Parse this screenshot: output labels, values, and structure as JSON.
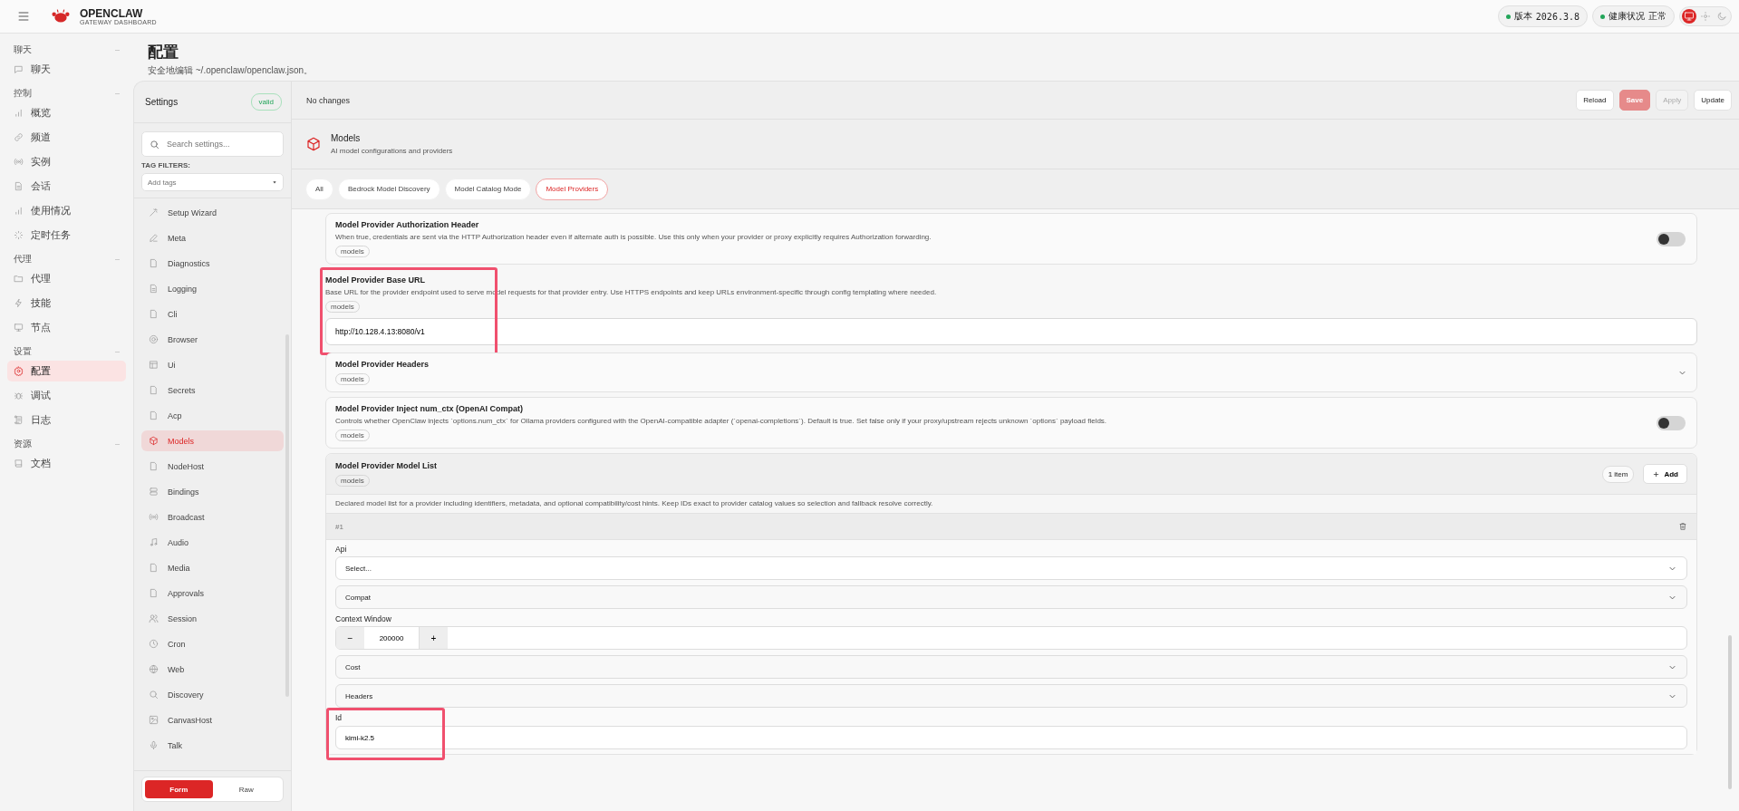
{
  "topbar": {
    "brand": "OPENCLAW",
    "subtitle": "GATEWAY DASHBOARD",
    "status_pills": [
      {
        "label": "版本",
        "value": "2026.3.8",
        "color": "#22a559"
      },
      {
        "label": "健康状况",
        "value": "正常",
        "color": "#22a559"
      }
    ],
    "theme_modes": [
      {
        "kind": "system",
        "selected": true
      },
      {
        "kind": "light",
        "selected": false
      },
      {
        "kind": "dark",
        "selected": false
      }
    ]
  },
  "nav": [
    {
      "title": "聊天",
      "items": [
        {
          "label": "聊天",
          "kind": "chat",
          "selected": false
        }
      ]
    },
    {
      "title": "控制",
      "items": [
        {
          "label": "概览",
          "kind": "bars",
          "selected": false
        },
        {
          "label": "频道",
          "kind": "link",
          "selected": false
        },
        {
          "label": "实例",
          "kind": "radio",
          "selected": false
        },
        {
          "label": "会话",
          "kind": "doc",
          "selected": false
        },
        {
          "label": "使用情况",
          "kind": "bars",
          "selected": false
        },
        {
          "label": "定时任务",
          "kind": "spinner",
          "selected": false
        }
      ]
    },
    {
      "title": "代理",
      "items": [
        {
          "label": "代理",
          "kind": "folder",
          "selected": false
        },
        {
          "label": "技能",
          "kind": "bolt",
          "selected": false
        },
        {
          "label": "节点",
          "kind": "monitor",
          "selected": false
        }
      ]
    },
    {
      "title": "设置",
      "items": [
        {
          "label": "配置",
          "kind": "gear",
          "selected": true
        },
        {
          "label": "调试",
          "kind": "bug",
          "selected": false
        },
        {
          "label": "日志",
          "kind": "scroll",
          "selected": false
        }
      ]
    },
    {
      "title": "资源",
      "items": [
        {
          "label": "文档",
          "kind": "book",
          "selected": false
        }
      ]
    }
  ],
  "page": {
    "title": "配置",
    "subtitle": "安全地编辑 ~/.openclaw/openclaw.json。"
  },
  "settings": {
    "title": "Settings",
    "status": "valid",
    "search_placeholder": "Search settings...",
    "tag_filters_label": "TAG FILTERS:",
    "tags_placeholder": "Add tags",
    "sections": [
      {
        "label": "Setup Wizard",
        "kind": "wand",
        "selected": false
      },
      {
        "label": "Meta",
        "kind": "pen",
        "selected": false
      },
      {
        "label": "Diagnostics",
        "kind": "file",
        "selected": false
      },
      {
        "label": "Logging",
        "kind": "doc",
        "selected": false
      },
      {
        "label": "Cli",
        "kind": "file",
        "selected": false
      },
      {
        "label": "Browser",
        "kind": "ring",
        "selected": false
      },
      {
        "label": "Ui",
        "kind": "layout",
        "selected": false
      },
      {
        "label": "Secrets",
        "kind": "file",
        "selected": false
      },
      {
        "label": "Acp",
        "kind": "file",
        "selected": false
      },
      {
        "label": "Models",
        "kind": "cube",
        "selected": true
      },
      {
        "label": "NodeHost",
        "kind": "file",
        "selected": false
      },
      {
        "label": "Bindings",
        "kind": "server",
        "selected": false
      },
      {
        "label": "Broadcast",
        "kind": "radio",
        "selected": false
      },
      {
        "label": "Audio",
        "kind": "music",
        "selected": false
      },
      {
        "label": "Media",
        "kind": "file",
        "selected": false
      },
      {
        "label": "Approvals",
        "kind": "file",
        "selected": false
      },
      {
        "label": "Session",
        "kind": "users",
        "selected": false
      },
      {
        "label": "Cron",
        "kind": "clock",
        "selected": false
      },
      {
        "label": "Web",
        "kind": "globe",
        "selected": false
      },
      {
        "label": "Discovery",
        "kind": "search",
        "selected": false
      },
      {
        "label": "CanvasHost",
        "kind": "image",
        "selected": false
      },
      {
        "label": "Talk",
        "kind": "mic",
        "selected": false
      }
    ],
    "modes": [
      {
        "label": "Form",
        "selected": true
      },
      {
        "label": "Raw",
        "selected": false
      }
    ]
  },
  "toolbar": {
    "status": "No changes",
    "buttons": [
      {
        "label": "Reload",
        "kind": "default",
        "disabled": false
      },
      {
        "label": "Save",
        "kind": "primary",
        "disabled": true
      },
      {
        "label": "Apply",
        "kind": "default",
        "disabled": true
      },
      {
        "label": "Update",
        "kind": "default",
        "disabled": false
      }
    ]
  },
  "section": {
    "title": "Models",
    "description": "AI model configurations and providers",
    "tabs": [
      {
        "label": "All",
        "selected": false
      },
      {
        "label": "Bedrock Model Discovery",
        "selected": false
      },
      {
        "label": "Model Catalog Mode",
        "selected": false
      },
      {
        "label": "Model Providers",
        "selected": true
      }
    ]
  },
  "fields": [
    {
      "kind": "toggle",
      "title": "Model Provider Authorization Header",
      "description": "When true, credentials are sent via the HTTP Authorization header even if alternate auth is possible. Use this only when your provider or proxy explicitly requires Authorization forwarding.",
      "tag": "models",
      "on": false
    },
    {
      "kind": "text",
      "title": "Model Provider Base URL",
      "description": "Base URL for the provider endpoint used to serve model requests for that provider entry. Use HTTPS endpoints and keep URLs environment-specific through config templating where needed.",
      "tag": "models",
      "value": "http://10.128.4.13:8080/v1",
      "highlighted": true
    },
    {
      "kind": "collapsible",
      "title": "Model Provider Headers",
      "tag": "models"
    },
    {
      "kind": "toggle",
      "title": "Model Provider Inject num_ctx (OpenAI Compat)",
      "description": "Controls whether OpenClaw injects `options.num_ctx` for Ollama providers configured with the OpenAI-compatible adapter (`openai-completions`). Default is true. Set false only if your proxy/upstream rejects unknown `options` payload fields.",
      "tag": "models",
      "on": false
    },
    {
      "kind": "list",
      "title": "Model Provider Model List",
      "tag": "models",
      "count": "1 item",
      "add_label": "Add",
      "description": "Declared model list for a provider including identifiers, metadata, and optional compatibility/cost hints. Keep IDs exact to provider catalog values so selection and fallback resolve correctly.",
      "items": [
        {
          "index": "#1",
          "fields": [
            {
              "kind": "select",
              "label": "Api",
              "placeholder": "Select..."
            },
            {
              "kind": "collapsible",
              "label": "Compat"
            },
            {
              "kind": "number",
              "label": "Context Window",
              "value": "200000",
              "minus": "−",
              "plus": "+"
            },
            {
              "kind": "collapsible",
              "label": "Cost"
            },
            {
              "kind": "collapsible",
              "label": "Headers"
            },
            {
              "kind": "text",
              "label": "Id",
              "value": "kimi-k2.5",
              "highlighted": true
            }
          ]
        }
      ]
    }
  ]
}
